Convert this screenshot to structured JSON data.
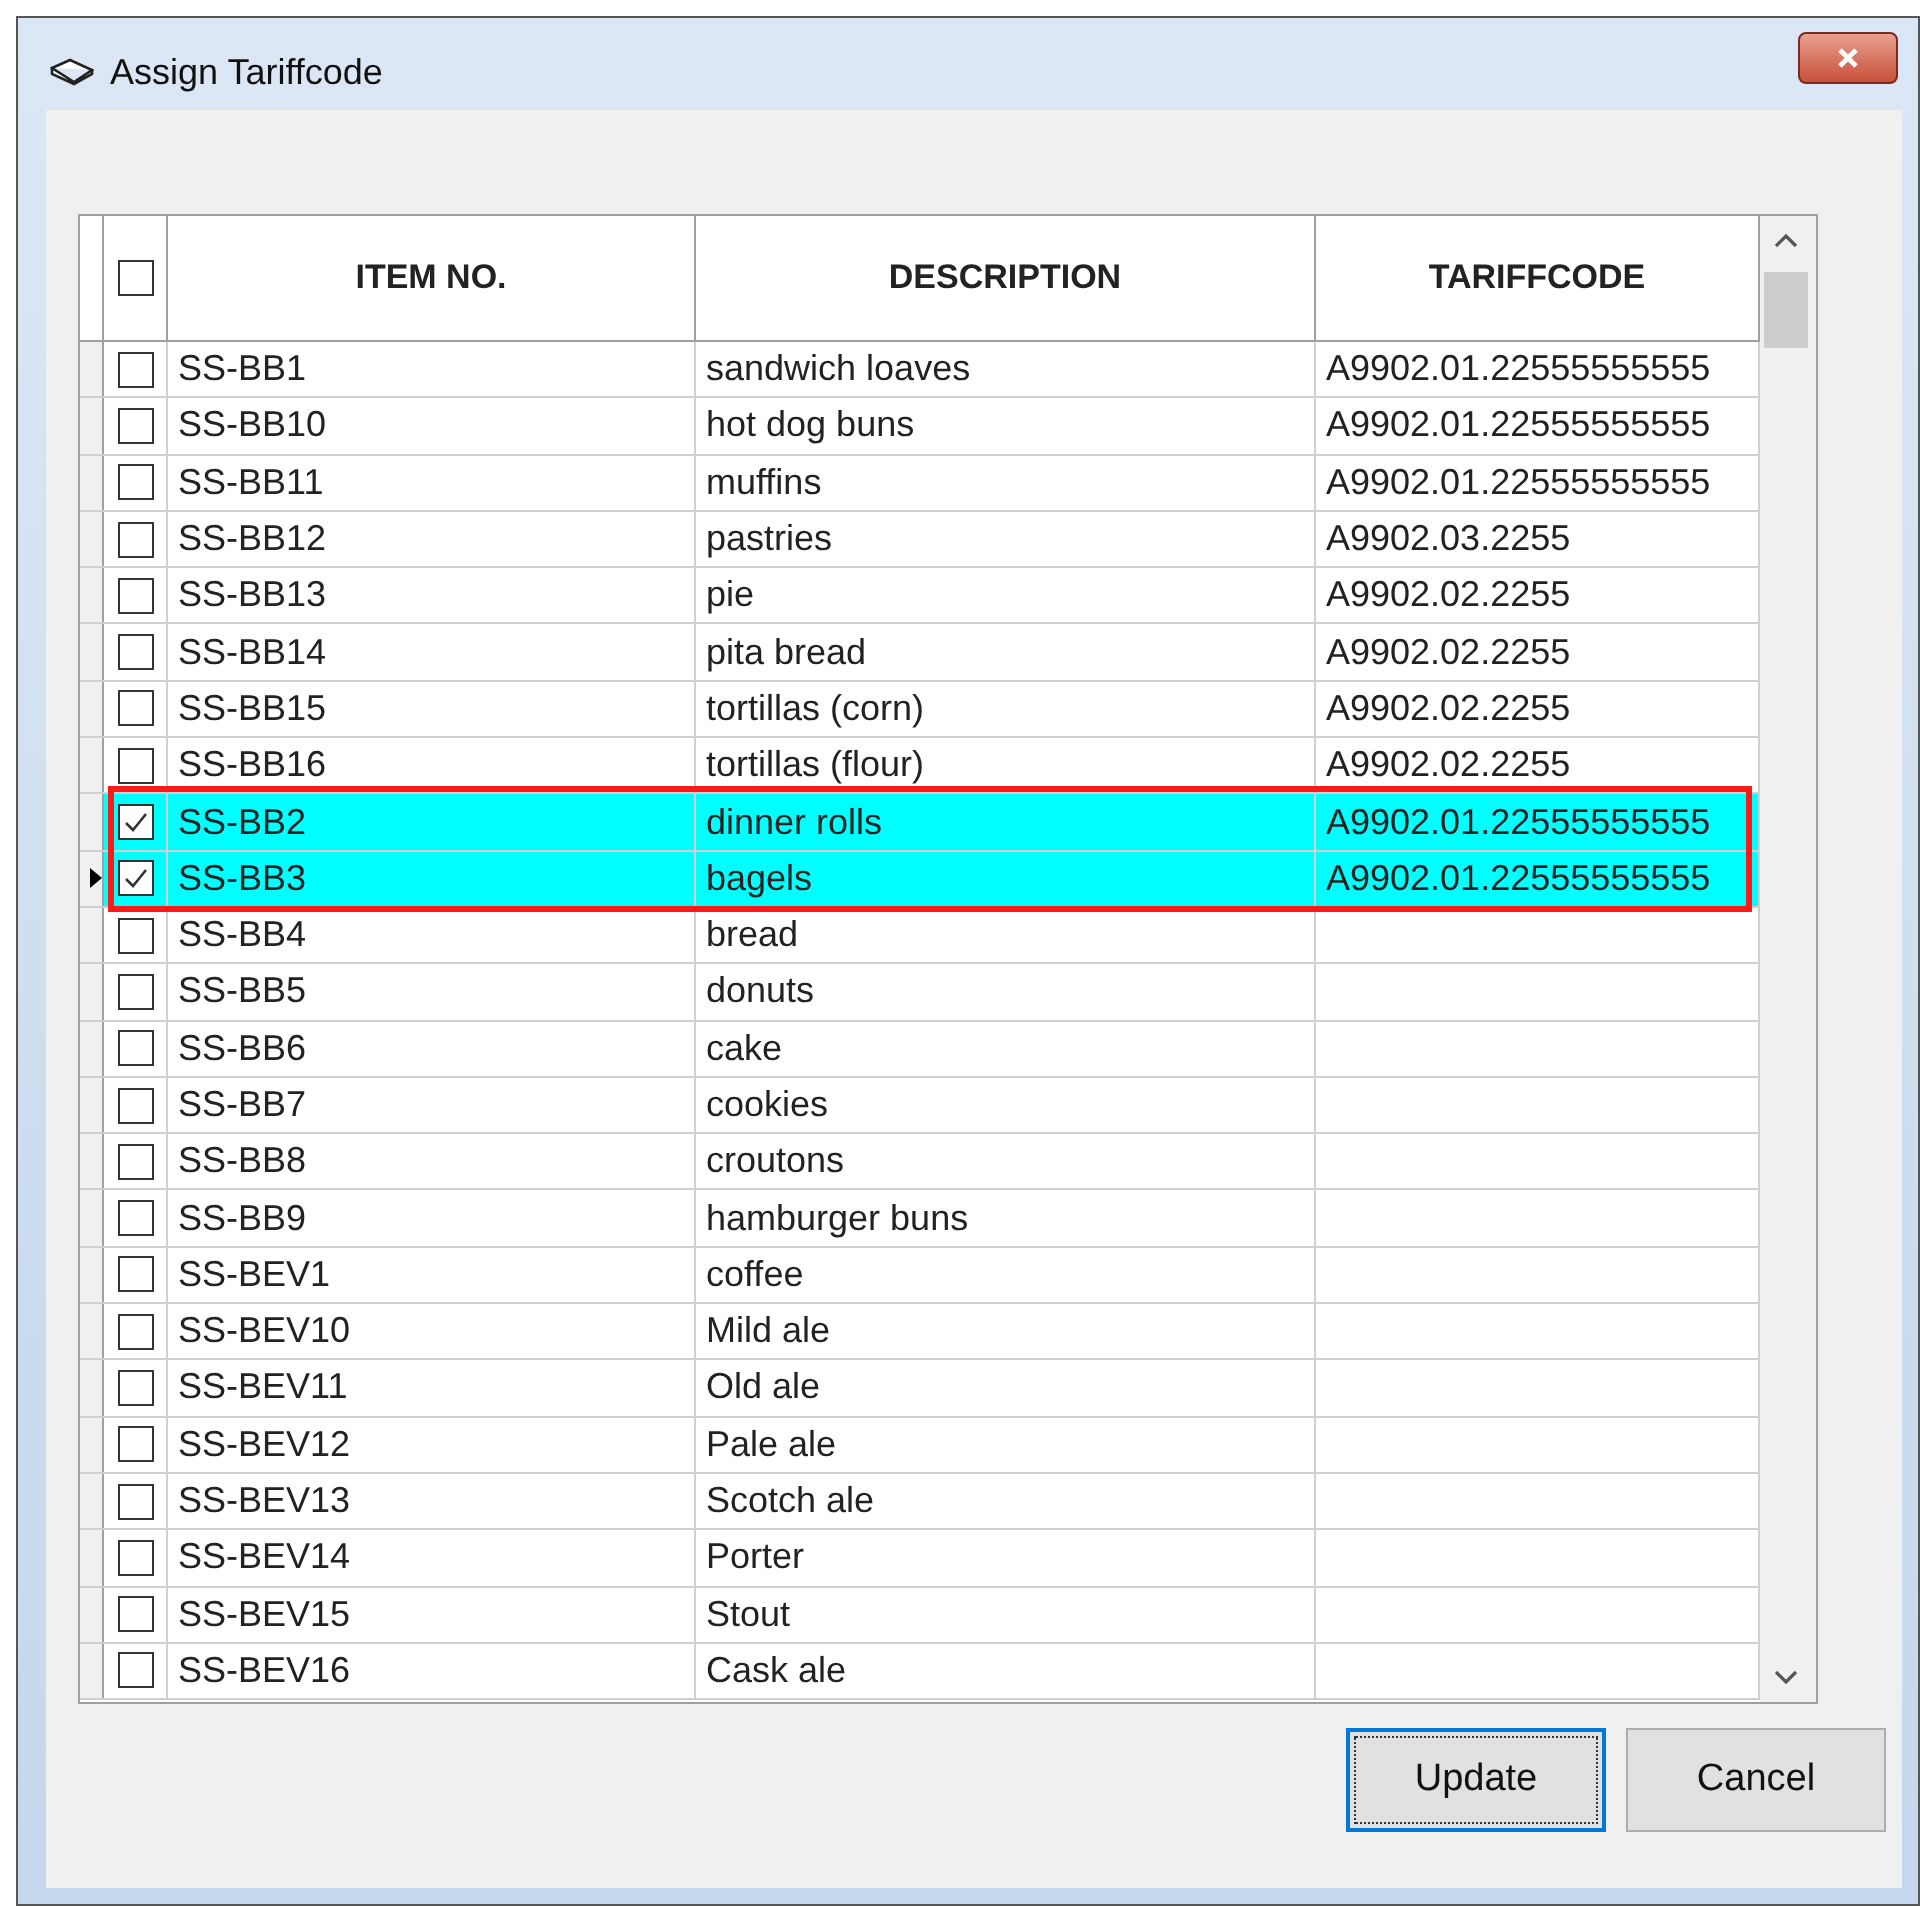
{
  "window": {
    "title": "Assign Tariffcode"
  },
  "table": {
    "header_checked": false,
    "columns": [
      "ITEM NO.",
      "DESCRIPTION",
      "TARIFFCODE"
    ],
    "rows": [
      {
        "item": "SS-BB1",
        "description": "sandwich loaves",
        "tariffcode": "A9902.01.22555555555",
        "checked": false,
        "selected": false,
        "current": false
      },
      {
        "item": "SS-BB10",
        "description": "hot dog buns",
        "tariffcode": "A9902.01.22555555555",
        "checked": false,
        "selected": false,
        "current": false
      },
      {
        "item": "SS-BB11",
        "description": "muffins",
        "tariffcode": "A9902.01.22555555555",
        "checked": false,
        "selected": false,
        "current": false
      },
      {
        "item": "SS-BB12",
        "description": "pastries",
        "tariffcode": "A9902.03.2255",
        "checked": false,
        "selected": false,
        "current": false
      },
      {
        "item": "SS-BB13",
        "description": "pie",
        "tariffcode": "A9902.02.2255",
        "checked": false,
        "selected": false,
        "current": false
      },
      {
        "item": "SS-BB14",
        "description": "pita bread",
        "tariffcode": "A9902.02.2255",
        "checked": false,
        "selected": false,
        "current": false
      },
      {
        "item": "SS-BB15",
        "description": "tortillas (corn)",
        "tariffcode": "A9902.02.2255",
        "checked": false,
        "selected": false,
        "current": false
      },
      {
        "item": "SS-BB16",
        "description": "tortillas (flour)",
        "tariffcode": "A9902.02.2255",
        "checked": false,
        "selected": false,
        "current": false
      },
      {
        "item": "SS-BB2",
        "description": "dinner rolls",
        "tariffcode": "A9902.01.22555555555",
        "checked": true,
        "selected": true,
        "current": false
      },
      {
        "item": "SS-BB3",
        "description": "bagels",
        "tariffcode": "A9902.01.22555555555",
        "checked": true,
        "selected": true,
        "current": true
      },
      {
        "item": "SS-BB4",
        "description": "bread",
        "checked": false,
        "selected": false,
        "current": false
      },
      {
        "item": "SS-BB5",
        "description": "donuts",
        "checked": false,
        "selected": false,
        "current": false
      },
      {
        "item": "SS-BB6",
        "description": "cake",
        "checked": false,
        "selected": false,
        "current": false
      },
      {
        "item": "SS-BB7",
        "description": "cookies",
        "checked": false,
        "selected": false,
        "current": false
      },
      {
        "item": "SS-BB8",
        "description": "croutons",
        "checked": false,
        "selected": false,
        "current": false
      },
      {
        "item": "SS-BB9",
        "description": "hamburger buns",
        "checked": false,
        "selected": false,
        "current": false
      },
      {
        "item": "SS-BEV1",
        "description": "coffee",
        "checked": false,
        "selected": false,
        "current": false
      },
      {
        "item": "SS-BEV10",
        "description": "Mild ale",
        "checked": false,
        "selected": false,
        "current": false
      },
      {
        "item": "SS-BEV11",
        "description": "Old ale",
        "checked": false,
        "selected": false,
        "current": false
      },
      {
        "item": "SS-BEV12",
        "description": "Pale ale",
        "checked": false,
        "selected": false,
        "current": false
      },
      {
        "item": "SS-BEV13",
        "description": "Scotch ale",
        "checked": false,
        "selected": false,
        "current": false
      },
      {
        "item": "SS-BEV14",
        "description": "Porter",
        "checked": false,
        "selected": false,
        "current": false
      },
      {
        "item": "SS-BEV15",
        "description": "Stout",
        "checked": false,
        "selected": false,
        "current": false
      },
      {
        "item": "SS-BEV16",
        "description": "Cask ale",
        "checked": false,
        "selected": false,
        "current": false
      }
    ]
  },
  "buttons": [
    {
      "label": "Update",
      "focused": true
    },
    {
      "label": "Cancel",
      "focused": false
    }
  ]
}
